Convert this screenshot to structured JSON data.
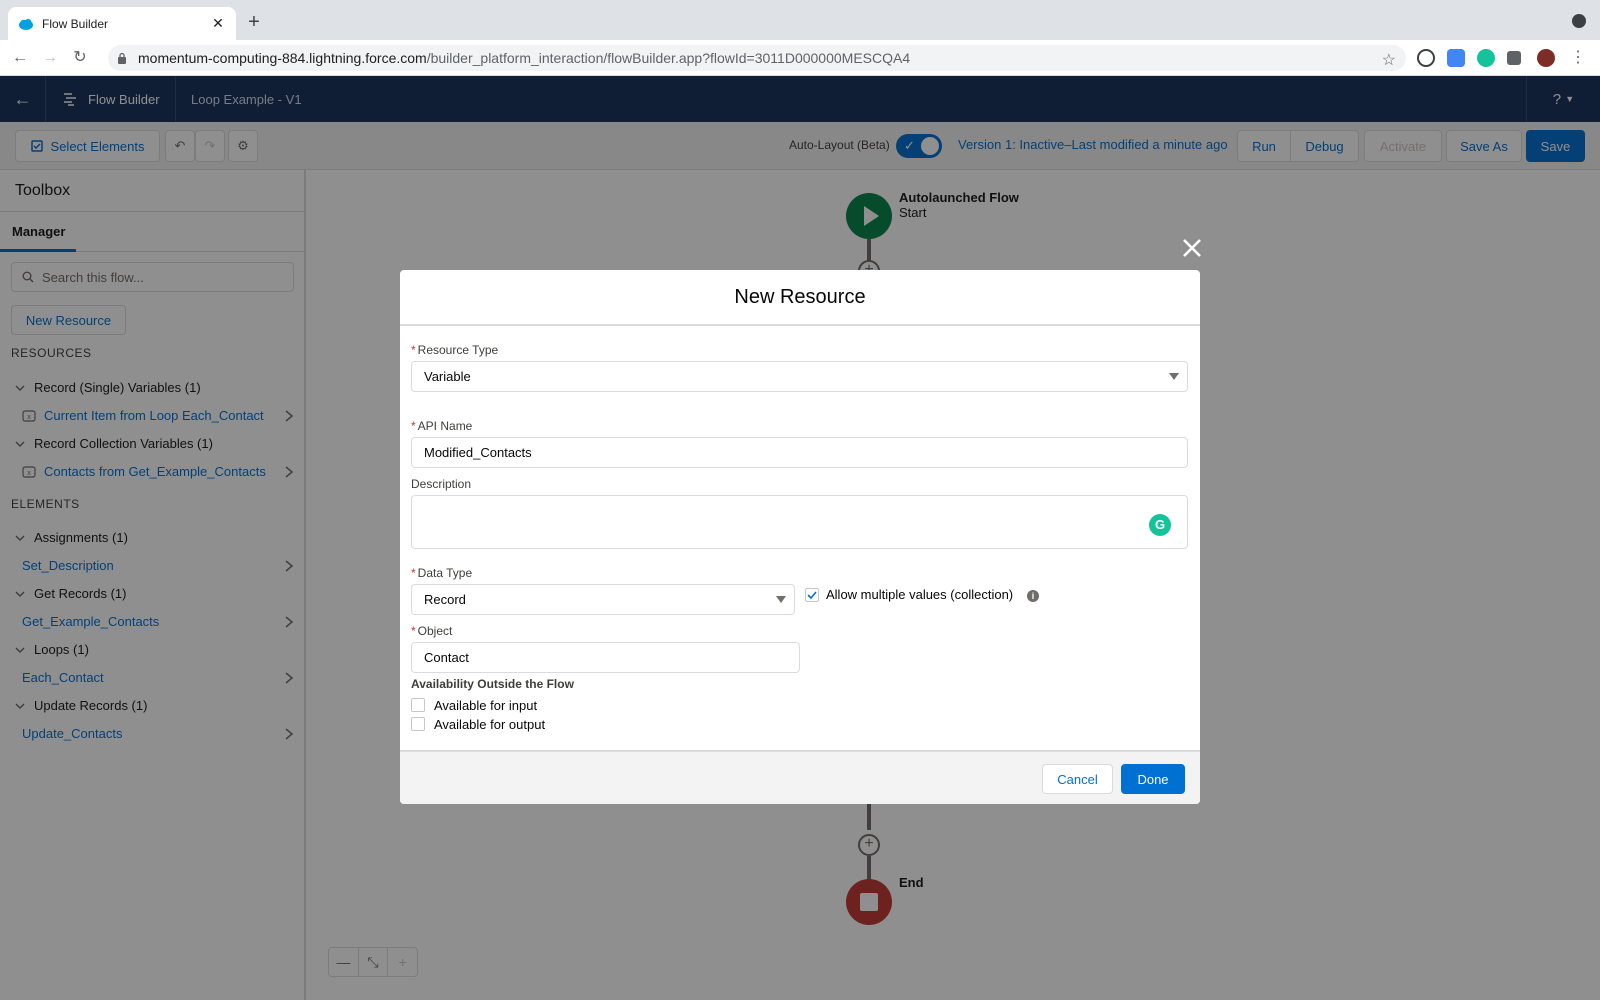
{
  "browser": {
    "tab_title": "Flow Builder",
    "url_host": "momentum-computing-884.lightning.force.com",
    "url_path": "/builder_platform_interaction/flowBuilder.app?flowId=3011D000000MESCQA4"
  },
  "header": {
    "app_name": "Flow Builder",
    "flow_name": "Loop Example - V1",
    "help_label": "?"
  },
  "toolbar": {
    "select_elements": "Select Elements",
    "auto_layout_label": "Auto-Layout (Beta)",
    "version_status": "Version 1: Inactive–Last modified a minute ago",
    "run": "Run",
    "debug": "Debug",
    "activate": "Activate",
    "save_as": "Save As",
    "save": "Save"
  },
  "toolbox": {
    "title": "Toolbox",
    "tab": "Manager",
    "search_placeholder": "Search this flow...",
    "new_resource": "New Resource",
    "resources_heading": "RESOURCES",
    "elements_heading": "ELEMENTS",
    "resource_groups": [
      {
        "label": "Record (Single) Variables (1)",
        "items": [
          "Current Item from Loop Each_Contact"
        ]
      },
      {
        "label": "Record Collection Variables (1)",
        "items": [
          "Contacts from Get_Example_Contacts"
        ]
      }
    ],
    "element_groups": [
      {
        "label": "Assignments (1)",
        "items": [
          "Set_Description"
        ]
      },
      {
        "label": "Get Records (1)",
        "items": [
          "Get_Example_Contacts"
        ]
      },
      {
        "label": "Loops (1)",
        "items": [
          "Each_Contact"
        ]
      },
      {
        "label": "Update Records (1)",
        "items": [
          "Update_Contacts"
        ]
      }
    ]
  },
  "canvas": {
    "start_title": "Autolaunched Flow",
    "start_sub": "Start",
    "end_label": "End"
  },
  "modal": {
    "title": "New Resource",
    "resource_type_label": "Resource Type",
    "resource_type_value": "Variable",
    "api_name_label": "API Name",
    "api_name_value": "Modified_Contacts",
    "description_label": "Description",
    "description_value": "",
    "data_type_label": "Data Type",
    "data_type_value": "Record",
    "allow_multiple_label": "Allow multiple values (collection)",
    "allow_multiple_checked": true,
    "object_label": "Object",
    "object_value": "Contact",
    "availability_title": "Availability Outside the Flow",
    "available_input_label": "Available for input",
    "available_output_label": "Available for output",
    "cancel": "Cancel",
    "done": "Done",
    "required_mark": "*"
  },
  "colors": {
    "brand_header": "#16325c",
    "brand_blue": "#0070d2",
    "start_node": "#04844b",
    "end_node": "#c23934"
  }
}
